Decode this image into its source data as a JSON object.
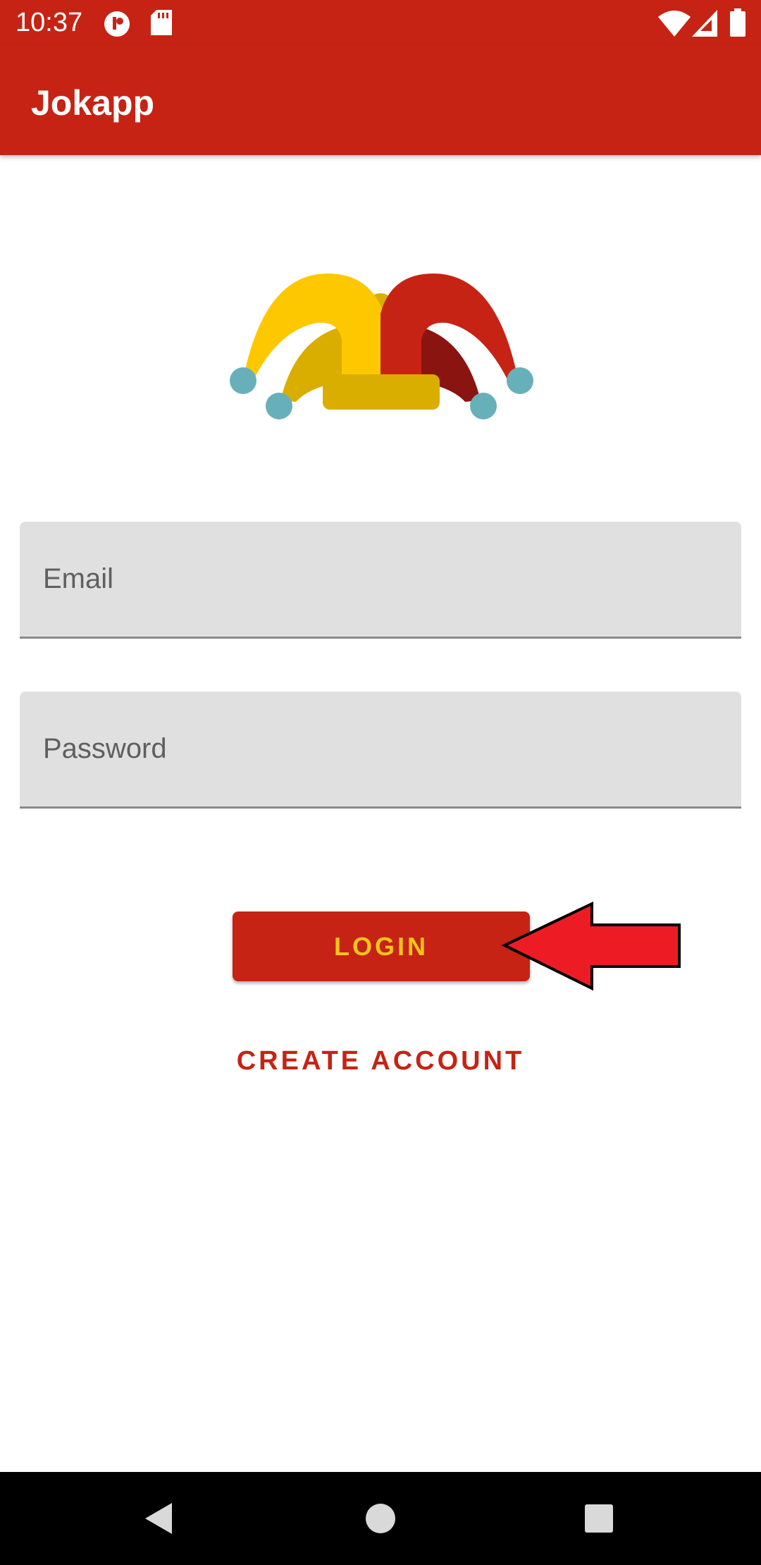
{
  "status_bar": {
    "time": "10:37",
    "left_icons": [
      "notification-app-icon",
      "sd-card-icon"
    ],
    "right_icons": [
      "wifi-icon",
      "cell-signal-icon",
      "battery-icon"
    ]
  },
  "app_bar": {
    "title": "Jokapp"
  },
  "logo": {
    "name": "jester-hat-logo",
    "colors": {
      "yellow": "#fdc800",
      "dark_yellow": "#d9ae00",
      "red": "#c62314",
      "dark_red": "#8a1410",
      "bells": "#67b0b9"
    }
  },
  "form": {
    "email": {
      "value": "",
      "placeholder": "Email"
    },
    "password": {
      "value": "",
      "placeholder": "Password"
    },
    "login_label": "LOGIN",
    "create_account_label": "CREATE ACCOUNT"
  },
  "nav_bar": {
    "buttons": [
      "back-icon",
      "home-icon",
      "recents-icon"
    ]
  },
  "colors": {
    "primary": "#c62314",
    "login_text": "#f5c518",
    "field_background": "#e0e0e0",
    "annotation_arrow": "#ed1c24"
  }
}
